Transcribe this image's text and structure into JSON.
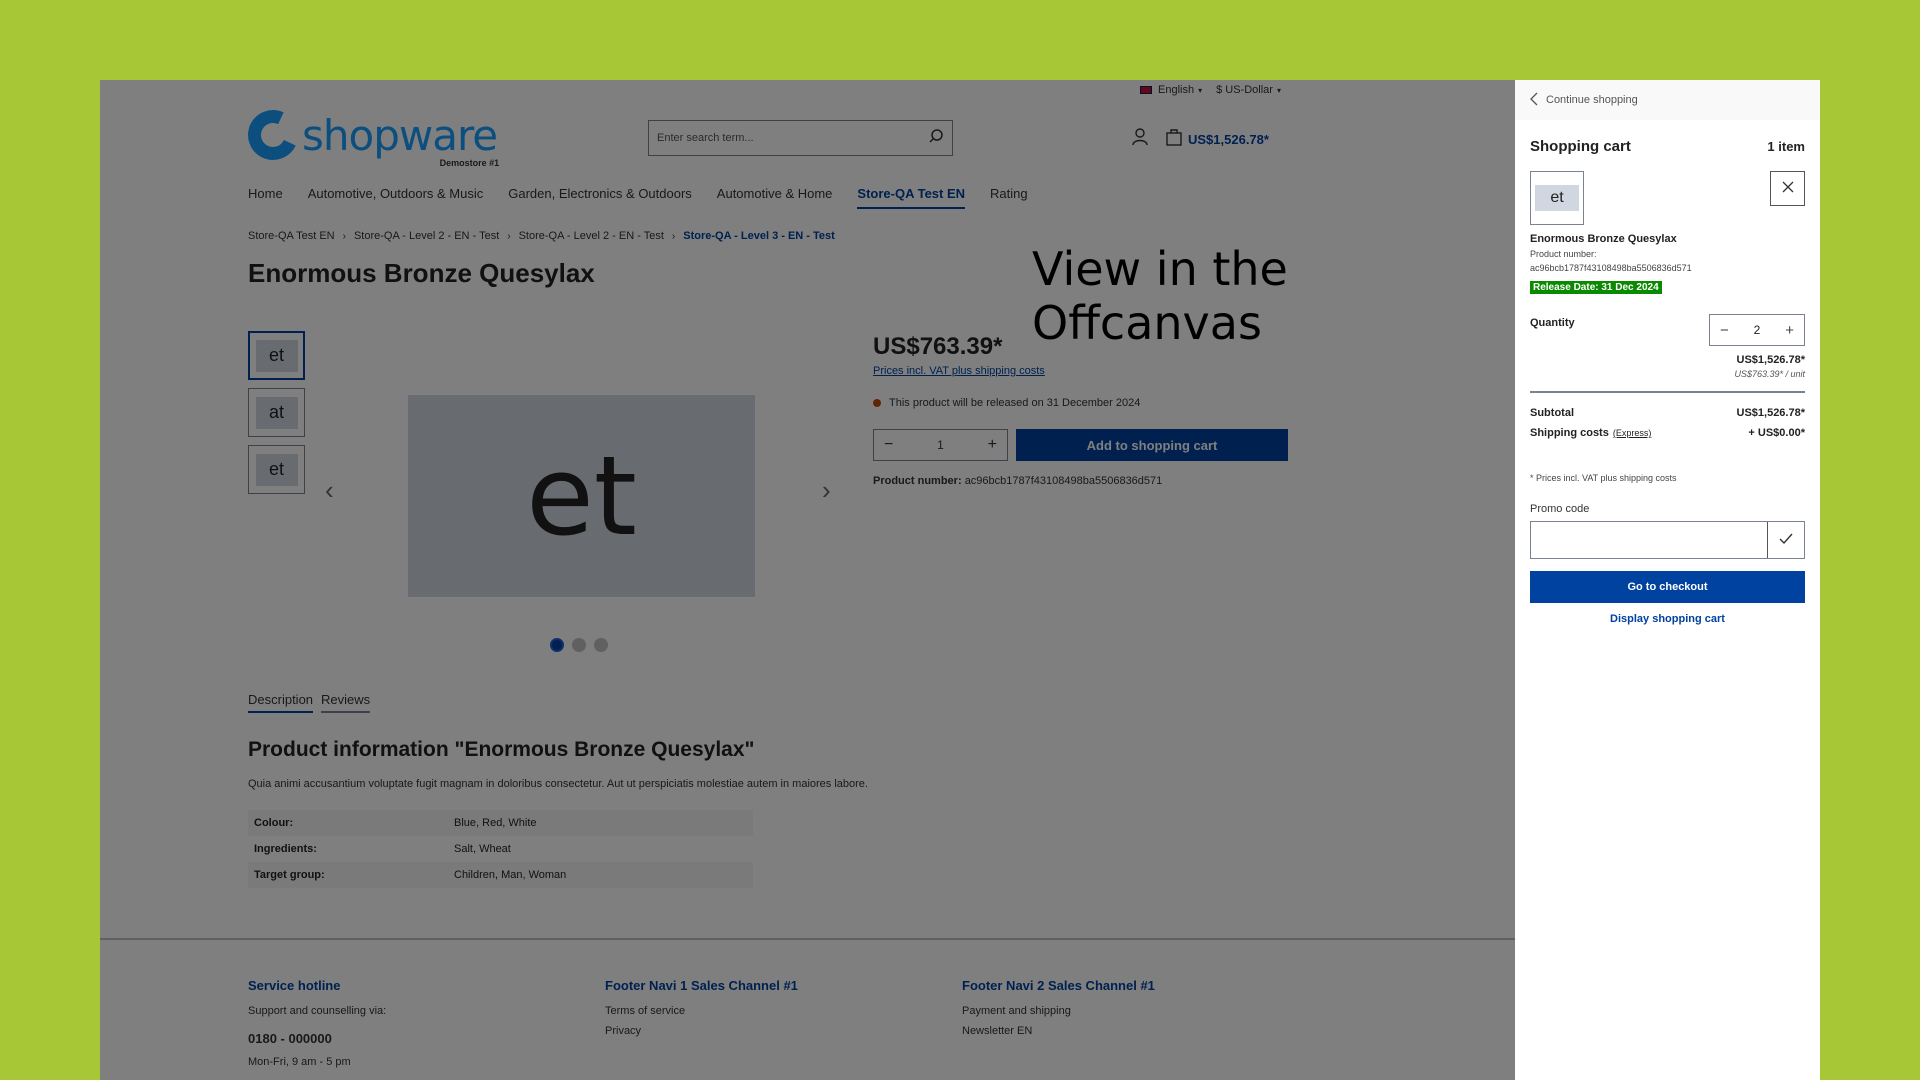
{
  "topbar": {
    "language": "English",
    "currency": "$ US-Dollar"
  },
  "logo": {
    "text": "shopware",
    "subtext": "Demostore #1"
  },
  "search": {
    "placeholder": "Enter search term..."
  },
  "header": {
    "cart_total": "US$1,526.78*"
  },
  "nav": {
    "items": [
      {
        "label": "Home"
      },
      {
        "label": "Automotive, Outdoors & Music"
      },
      {
        "label": "Garden, Electronics & Outdoors"
      },
      {
        "label": "Automotive & Home"
      },
      {
        "label": "Store-QA Test EN",
        "active": true
      },
      {
        "label": "Rating"
      }
    ]
  },
  "breadcrumb": {
    "items": [
      "Store-QA Test EN",
      "Store-QA - Level 2 - EN - Test",
      "Store-QA - Level 2 - EN - Test",
      "Store-QA - Level 3 - EN - Test"
    ],
    "separator": "›"
  },
  "product": {
    "title": "Enormous Bronze Quesylax",
    "price": "US$763.39*",
    "vat_link": "Prices incl. VAT plus shipping costs",
    "delivery": "This product will be released on 31 December 2024",
    "quantity": "1",
    "add_to_cart": "Add to shopping cart",
    "product_number_label": "Product number:",
    "product_number": "ac96bcb1787f43108498ba5506836d571",
    "thumbnails": [
      "et",
      "at",
      "et"
    ],
    "main_image_text": "et",
    "gallery_dots": 3,
    "active_dot": 1
  },
  "overlay_label": "View in the Offcanvas",
  "tabs": {
    "description": "Description",
    "reviews": "Reviews"
  },
  "info": {
    "title": "Product information \"Enormous Bronze Quesylax\"",
    "description": "Quia animi accusantium voluptate fugit magnam in doloribus consectetur. Aut ut perspiciatis molestiae autem in maiores labore.",
    "properties": [
      {
        "label": "Colour:",
        "value": "Blue, Red, White"
      },
      {
        "label": "Ingredients:",
        "value": "Salt, Wheat"
      },
      {
        "label": "Target group:",
        "value": "Children, Man, Woman"
      }
    ]
  },
  "footer": {
    "col1": {
      "title": "Service hotline",
      "line1": "Support and counselling via:",
      "phone": "0180 - 000000",
      "hours": "Mon-Fri, 9 am - 5 pm"
    },
    "col2": {
      "title": "Footer Navi 1 Sales Channel #1",
      "links": [
        "Terms of service",
        "Privacy"
      ]
    },
    "col3": {
      "title": "Footer Navi 2 Sales Channel #1",
      "links": [
        "Payment and shipping",
        "Newsletter EN"
      ]
    }
  },
  "offcanvas": {
    "continue": "Continue shopping",
    "title": "Shopping cart",
    "count": "1 item",
    "item": {
      "thumb_text": "et",
      "name": "Enormous Bronze Quesylax",
      "pn_label": "Product number:",
      "pn": "ac96bcb1787f43108498ba5506836d571",
      "release": "Release Date: 31 Dec 2024",
      "quantity_label": "Quantity",
      "quantity": "2",
      "line_price": "US$1,526.78*",
      "unit_price": "US$763.39* / unit"
    },
    "subtotal_label": "Subtotal",
    "subtotal": "US$1,526.78*",
    "shipping_label": "Shipping costs",
    "shipping_method": "(Express)",
    "shipping": "+ US$0.00*",
    "note": "* Prices incl. VAT plus shipping costs",
    "promo_label": "Promo code",
    "promo_value": "",
    "checkout": "Go to checkout",
    "display_cart": "Display shopping cart"
  },
  "colors": {
    "background": "#a7c736",
    "primary": "#0042a0",
    "release_badge": "#0a8a00",
    "delivery_dot": "#c04a0a"
  }
}
